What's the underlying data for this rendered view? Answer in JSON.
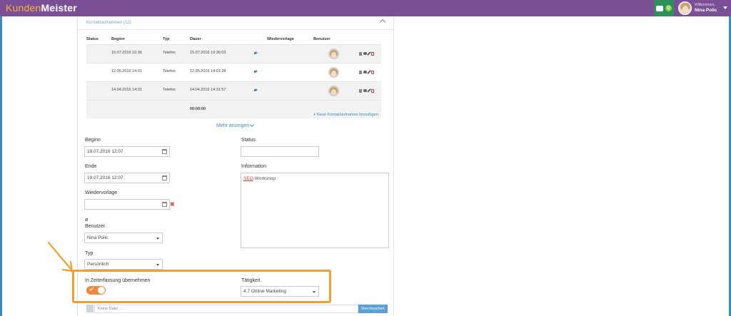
{
  "header": {
    "logo_part1": "Kunden",
    "logo_part2": "Meister",
    "chat_badge": "0",
    "user_welcome": "Willkommen,",
    "user_name": "Nina Polic"
  },
  "contacts": {
    "title": "Kontaktaufnahmen (12)",
    "columns": [
      "Status",
      "Beginn",
      "Typ",
      "Dauer",
      "Wiedervorlage",
      "Benutzer"
    ],
    "rows": [
      {
        "begin": "15.07.2016 10:36",
        "type": "Telefon",
        "duration": "15.07.2016 10:36:03"
      },
      {
        "begin": "12.05.2016 14:01",
        "type": "Telefon",
        "duration": "12.05.2016 14:01:28"
      },
      {
        "begin": "14.04.2016 14:31",
        "type": "Telefon",
        "duration": "14.04.2016 14:31:57"
      }
    ],
    "total": "00:00:00",
    "add_link": "Neue Kontaktaufnahme hinzufügen",
    "more": "Mehr anzeigen"
  },
  "form": {
    "begin_label": "Beginn",
    "begin_value": "19.07.2016 12:07",
    "end_label": "Ende",
    "end_value": "19.07.2016 12:07",
    "followup_label": "Wiedervorlage",
    "followup_value": "",
    "user_symbol": "ø",
    "user_label": "Benutzer",
    "user_value": "Nina Polic",
    "type_label": "Typ",
    "type_value": "Persönlich",
    "status_label": "Status",
    "status_value": "",
    "info_label": "Information",
    "info_seo": "SEO",
    "info_rest": "-Workshop",
    "time_label": "In Zeiterfassung übernehmen",
    "time_enabled": true,
    "activity_label": "Tätigkeit",
    "activity_value": "4.7 Online Marketing",
    "file_placeholder": "Keine Datei ...",
    "file_button": "Durchsuchen"
  },
  "colors": {
    "topbar": "#7a4f96",
    "accent": "#3c8dbc",
    "highlight": "#f0a030",
    "toggle": "#f0893b"
  }
}
